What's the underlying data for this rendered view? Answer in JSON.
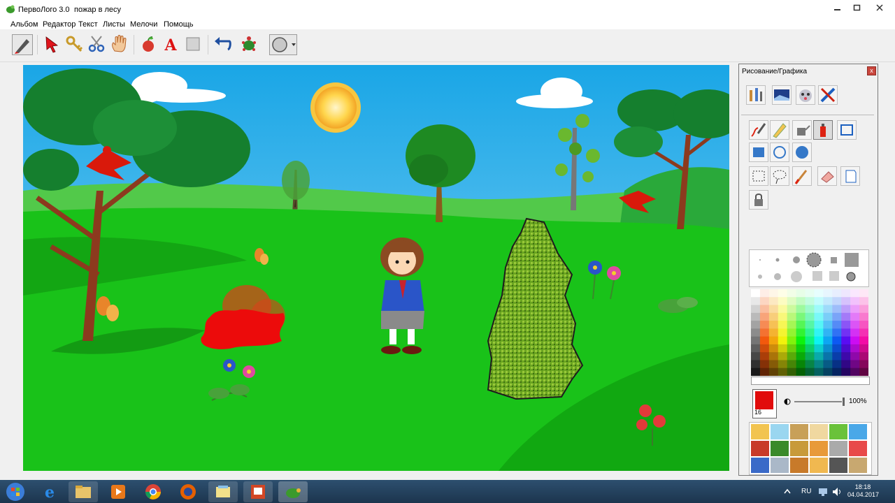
{
  "window": {
    "app_title": "ПервоЛого 3.0",
    "document_title": "пожар в лесу"
  },
  "menu": {
    "items": [
      "Альбом",
      "Редактор",
      "Текст",
      "Листы",
      "Мелочи",
      "Помощь"
    ]
  },
  "toolbar": {
    "icons": [
      "turtle-brush-icon",
      "pointer-icon",
      "key-icon",
      "scissors-icon",
      "hand-icon",
      "apple-icon",
      "text-icon",
      "square-icon",
      "undo-icon",
      "turtle-icon",
      "circle-shape-icon"
    ]
  },
  "panel": {
    "title": "Рисование/Графика",
    "close_label": "x",
    "brush_size": "16",
    "opacity": "100%",
    "current_color": "#e10b0b"
  },
  "taskbar": {
    "language": "RU",
    "time": "18:18",
    "date": "04.04.2017"
  }
}
